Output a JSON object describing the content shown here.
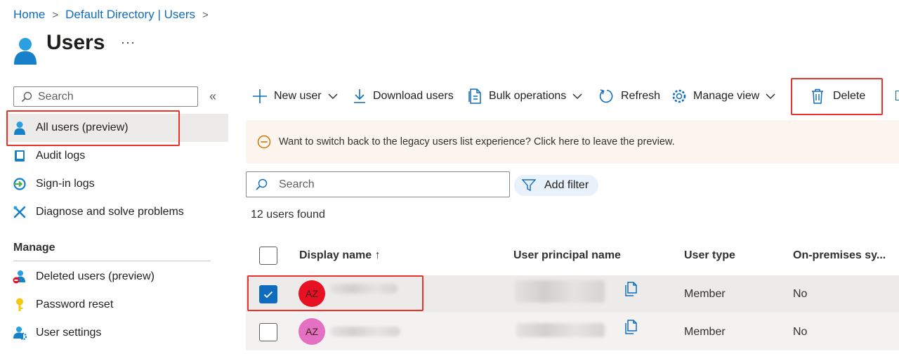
{
  "breadcrumb": {
    "home": "Home",
    "directory": "Default Directory | Users",
    "sep": ">"
  },
  "header": {
    "title": "Users",
    "more": "···"
  },
  "sidebar": {
    "search_placeholder": "Search",
    "collapse": "«",
    "items": [
      {
        "label": "All users (preview)",
        "icon": "user-icon"
      },
      {
        "label": "Audit logs",
        "icon": "book-icon"
      },
      {
        "label": "Sign-in logs",
        "icon": "sign-in-icon"
      },
      {
        "label": "Diagnose and solve problems",
        "icon": "wrench-icon"
      }
    ],
    "manage_label": "Manage",
    "manage_items": [
      {
        "label": "Deleted users (preview)",
        "icon": "deleted-user-icon"
      },
      {
        "label": "Password reset",
        "icon": "key-icon"
      },
      {
        "label": "User settings",
        "icon": "user-settings-icon"
      }
    ]
  },
  "toolbar": {
    "new_user": "New user",
    "download_users": "Download users",
    "bulk_operations": "Bulk operations",
    "refresh": "Refresh",
    "manage_view": "Manage view",
    "delete": "Delete"
  },
  "banner": {
    "text": "Want to switch back to the legacy users list experience? Click here to leave the preview."
  },
  "search": {
    "placeholder": "Search"
  },
  "filter": {
    "label": "Add filter"
  },
  "results": {
    "count": "12 users found"
  },
  "table": {
    "columns": [
      "Display name ↑",
      "User principal name",
      "User type",
      "On-premises sy..."
    ],
    "rows": [
      {
        "initials": "AZ",
        "avatar_color": "#e81123",
        "selected": true,
        "user_type": "Member",
        "on_prem": "No"
      },
      {
        "initials": "AZ",
        "avatar_color": "#e370c0",
        "selected": false,
        "user_type": "Member",
        "on_prem": "No"
      }
    ]
  },
  "colors": {
    "accent": "#0f6cbd",
    "highlight": "#e8322a",
    "banner_bg": "#fdf6ee",
    "warning": "#d47500"
  }
}
